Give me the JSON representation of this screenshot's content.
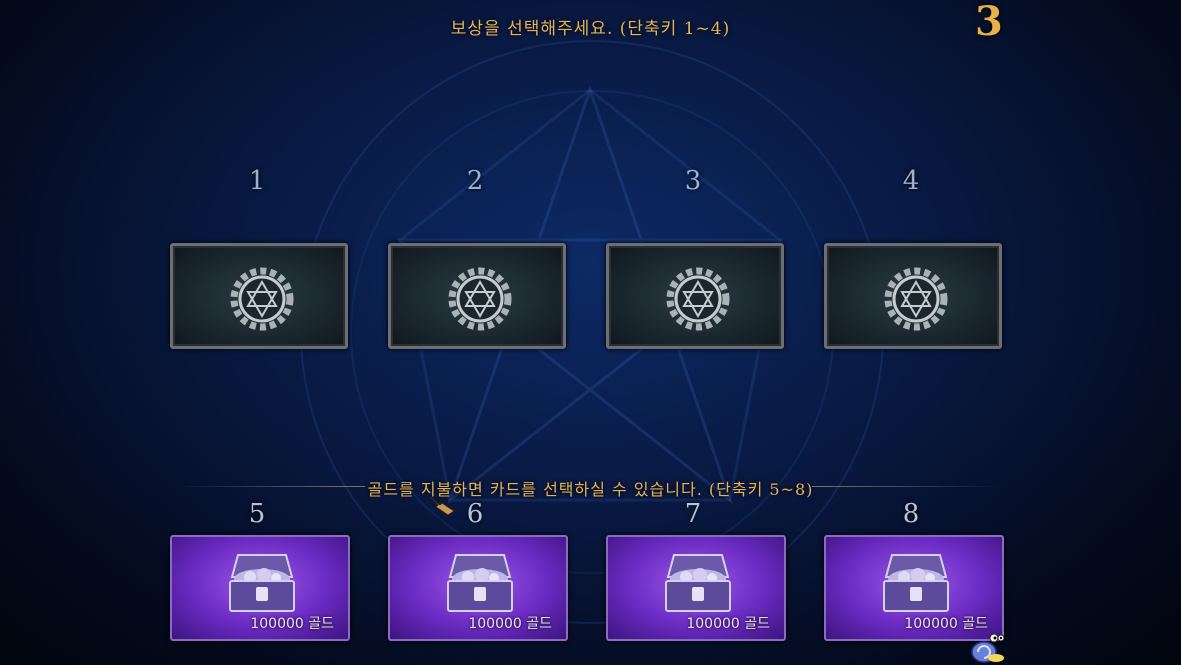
{
  "header": {
    "title": "보상을 선택해주세요. (단축키 1~4)",
    "countdown": "3"
  },
  "free_cards": [
    {
      "number": "1",
      "icon": "gear-star-icon"
    },
    {
      "number": "2",
      "icon": "gear-star-icon"
    },
    {
      "number": "3",
      "icon": "gear-star-icon"
    },
    {
      "number": "4",
      "icon": "gear-star-icon"
    }
  ],
  "paid_section": {
    "subtitle": "골드를 지불하면 카드를 선택하실 수 있습니다. (단축키 5~8)"
  },
  "gold_cards": [
    {
      "number": "5",
      "cost": "100000 골드",
      "icon": "treasure-chest-icon"
    },
    {
      "number": "6",
      "cost": "100000 골드",
      "icon": "treasure-chest-icon"
    },
    {
      "number": "7",
      "cost": "100000 골드",
      "icon": "treasure-chest-icon"
    },
    {
      "number": "8",
      "cost": "100000 골드",
      "icon": "treasure-chest-icon"
    }
  ],
  "colors": {
    "gold_text": "#e3b45a",
    "purple_card": "#6a2bc2",
    "slate_card": "#17232a"
  }
}
